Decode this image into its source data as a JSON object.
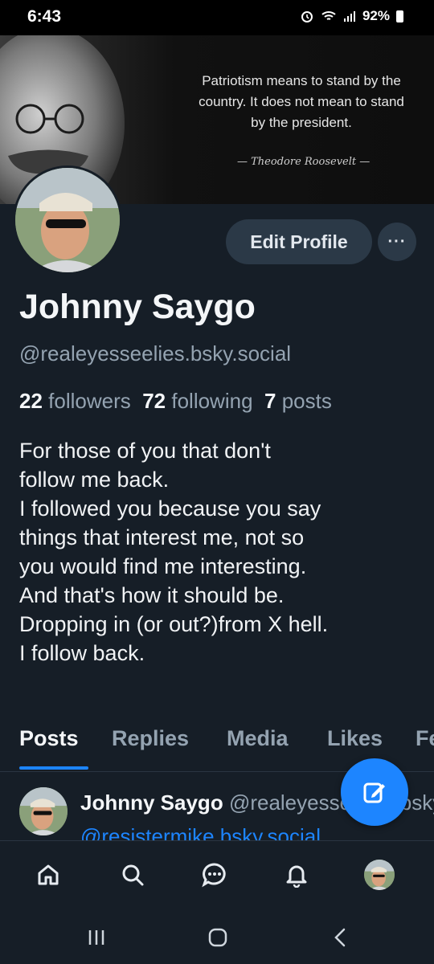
{
  "status_bar": {
    "time": "6:43",
    "battery": "92%"
  },
  "banner": {
    "quote_lines": [
      "Patriotism means to stand by the",
      "country. It does not mean to stand",
      "by the president."
    ],
    "attribution": "Theodore Roosevelt"
  },
  "profile": {
    "edit_label": "Edit Profile",
    "more_label": "···",
    "display_name": "Johnny Saygo",
    "handle": "@realeyesseelies.bsky.social",
    "followers_count": "22",
    "followers_label": "followers",
    "following_count": "72",
    "following_label": "following",
    "posts_count": "7",
    "posts_label": "posts",
    "bio_lines": [
      "For those of you that don't",
      "follow me back.",
      "I followed you because you say",
      "things that interest me, not so",
      "you would find me interesting.",
      "And that's how it should be.",
      "Dropping in (or out?)from X hell.",
      "I follow back."
    ]
  },
  "tabs": [
    "Posts",
    "Replies",
    "Media",
    "Likes",
    "Feeds"
  ],
  "post_preview": {
    "author": "Johnny Saygo",
    "handle": "@realeyesseelies.bsky.social",
    "mention": "@resistermike.bsky.social"
  },
  "bottom_nav": [
    "home-icon",
    "search-icon",
    "chat-icon",
    "bell-icon",
    "profile-avatar"
  ],
  "system_nav": [
    "recents-icon",
    "home-circle-icon",
    "back-icon"
  ],
  "colors": {
    "accent": "#1d85ff",
    "background": "#161e27",
    "button": "#2b3947"
  }
}
